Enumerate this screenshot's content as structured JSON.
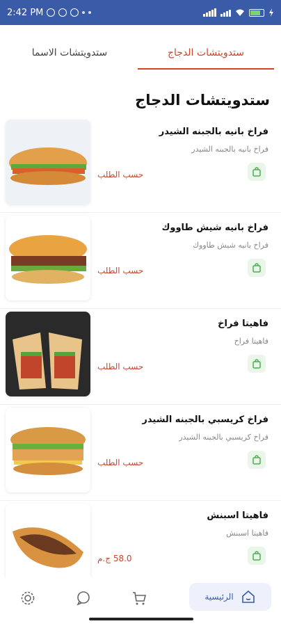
{
  "status_bar": {
    "time": "2:42 PM"
  },
  "tabs": [
    {
      "label": "ستدويتشات الاسما",
      "active": false
    },
    {
      "label": "ستدويتشات الدجاج",
      "active": true
    }
  ],
  "section_title": "ستدويتشات الدجاج",
  "products": [
    {
      "name": "فراخ بانيه بالجبنه الشيدر",
      "description": "فراخ بانيه بالجبنه الشيدر",
      "price": "حسب الطلب",
      "image_icon": "chicken-cheddar-sandwich"
    },
    {
      "name": "فراخ بانيه شيش طاووك",
      "description": "فراخ بانيه شيش طاووك",
      "price": "حسب الطلب",
      "image_icon": "shish-tawook-sandwich"
    },
    {
      "name": "فاهيتا فراخ",
      "description": "فاهيتا فراخ",
      "price": "حسب الطلب",
      "image_icon": "chicken-fajita-wrap"
    },
    {
      "name": "فراخ كريسبي بالجبنه الشيدر",
      "description": "فراخ كريسبي بالجبنه الشيدر",
      "price": "حسب الطلب",
      "image_icon": "crispy-chicken-sandwich"
    },
    {
      "name": "فاهيتا اسبنش",
      "description": "فاهيتا اسبنش",
      "price": "58.0 ج.م",
      "image_icon": "spanish-fajita-sandwich"
    }
  ],
  "bottom_nav": {
    "home_label": "الرئيسية"
  },
  "colors": {
    "status_bar": "#3a5ba8",
    "accent": "#c8462d",
    "cart_green": "#4caf50",
    "home_bg": "#eef0fb"
  }
}
